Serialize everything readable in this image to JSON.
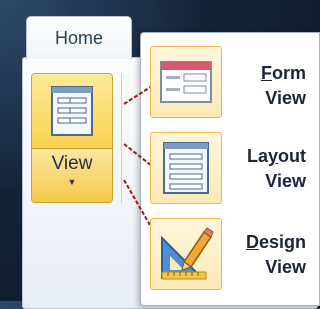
{
  "ribbon": {
    "tab_label": "Home",
    "view_button_label": "View",
    "view_button_arrow": "▼"
  },
  "menu": {
    "items": [
      {
        "line1": "Form",
        "line2": "View",
        "accelerator": "F",
        "icon": "form-view-icon"
      },
      {
        "line1": "Layout",
        "line2": "View",
        "accelerator": "y",
        "icon": "layout-view-icon"
      },
      {
        "line1": "Design",
        "line2": "View",
        "accelerator": "D",
        "icon": "design-view-icon"
      }
    ]
  },
  "colors": {
    "highlight": "#f9d24e",
    "connector": "#9b1b1b",
    "background": "#142438"
  }
}
